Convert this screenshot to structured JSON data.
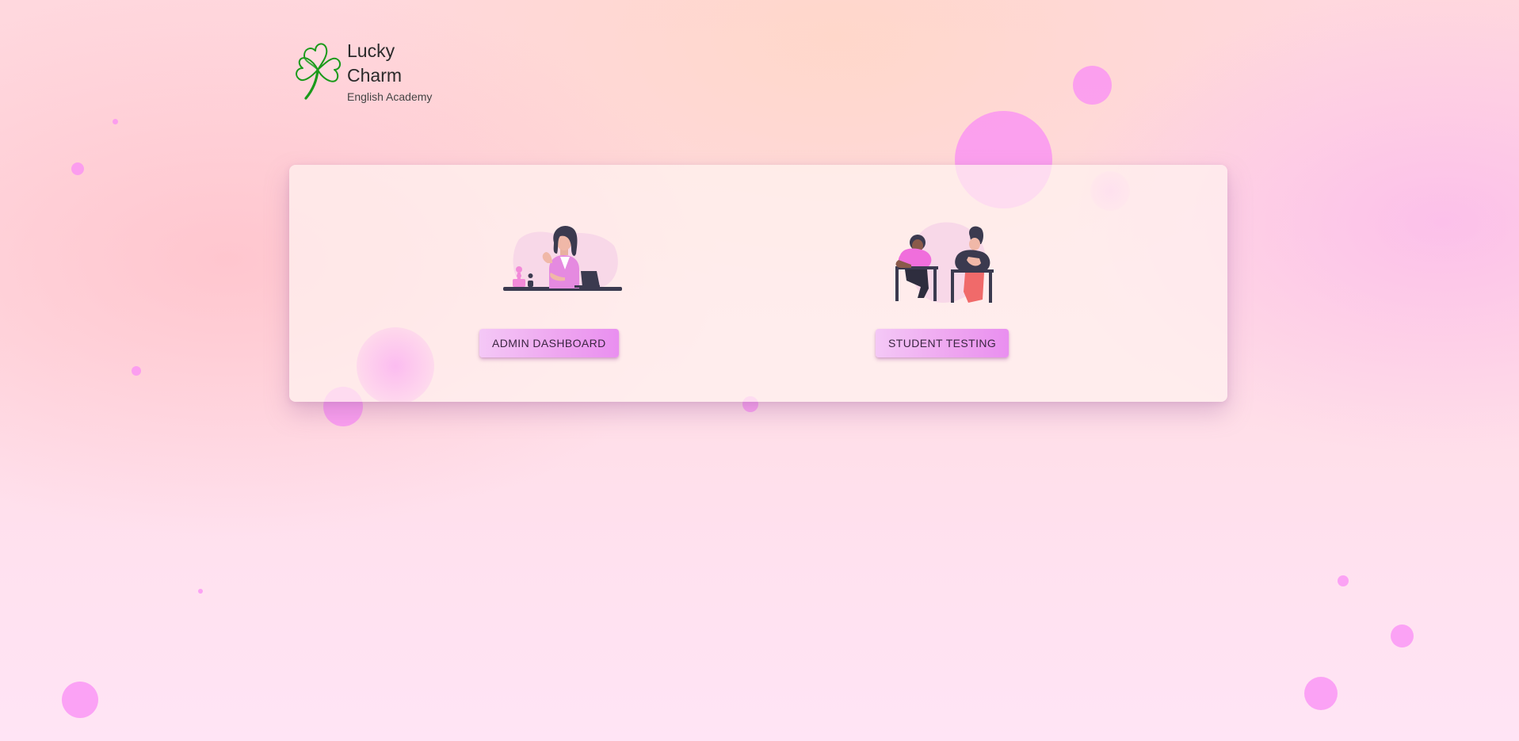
{
  "brand": {
    "title": "Lucky Charm",
    "subtitle": "English Academy",
    "logo_icon": "clover-icon",
    "accent_color": "#1a9a1a"
  },
  "options": [
    {
      "illustration": "admin-woman-laptop-illustration",
      "button_label": "ADMIN DASHBOARD"
    },
    {
      "illustration": "students-exam-illustration",
      "button_label": "STUDENT TESTING"
    }
  ],
  "colors": {
    "button_gradient_start": "#f4c8f6",
    "button_gradient_end": "#e98ff0",
    "bubble": "#fa8cf5"
  }
}
